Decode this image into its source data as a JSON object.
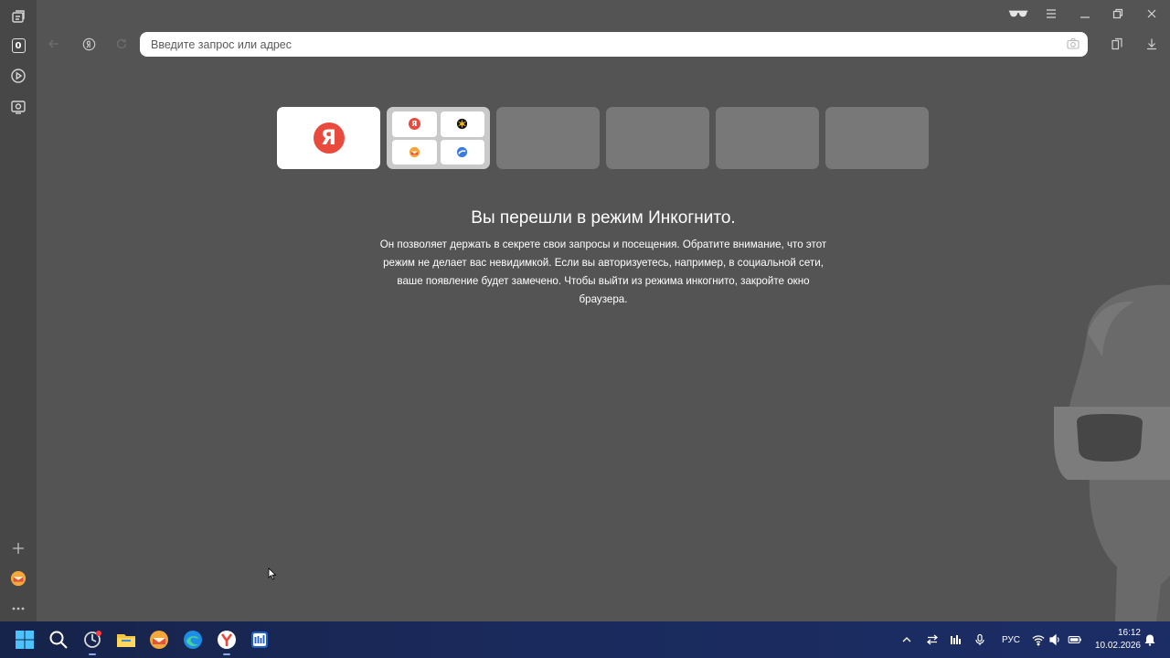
{
  "omnibox": {
    "placeholder": "Введите запрос или адрес"
  },
  "tiles": [
    {
      "name": "Яндекс",
      "type": "site"
    },
    {
      "name": "folder",
      "type": "group"
    },
    {
      "type": "empty"
    },
    {
      "type": "empty"
    },
    {
      "type": "empty"
    },
    {
      "type": "empty"
    }
  ],
  "incognito": {
    "title": "Вы перешли в режим Инкогнито.",
    "text": "Он позволяет держать в секрете свои запросы и посещения. Обратите внимание, что этот режим не делает вас невидимкой. Если вы авторизуетесь, например, в социальной сети, ваше появление будет замечено. Чтобы выйти из режима инкогнито, закройте окно браузера."
  },
  "sidebar": {
    "tab_count": "0"
  },
  "taskbar": {
    "language": "РУС",
    "time": "16:12",
    "date": "10.02.2026"
  },
  "colors": {
    "background": "#545454",
    "sidebar": "#474747",
    "yandex_red": "#e84a3e",
    "taskbar": "#1a2a5c"
  }
}
